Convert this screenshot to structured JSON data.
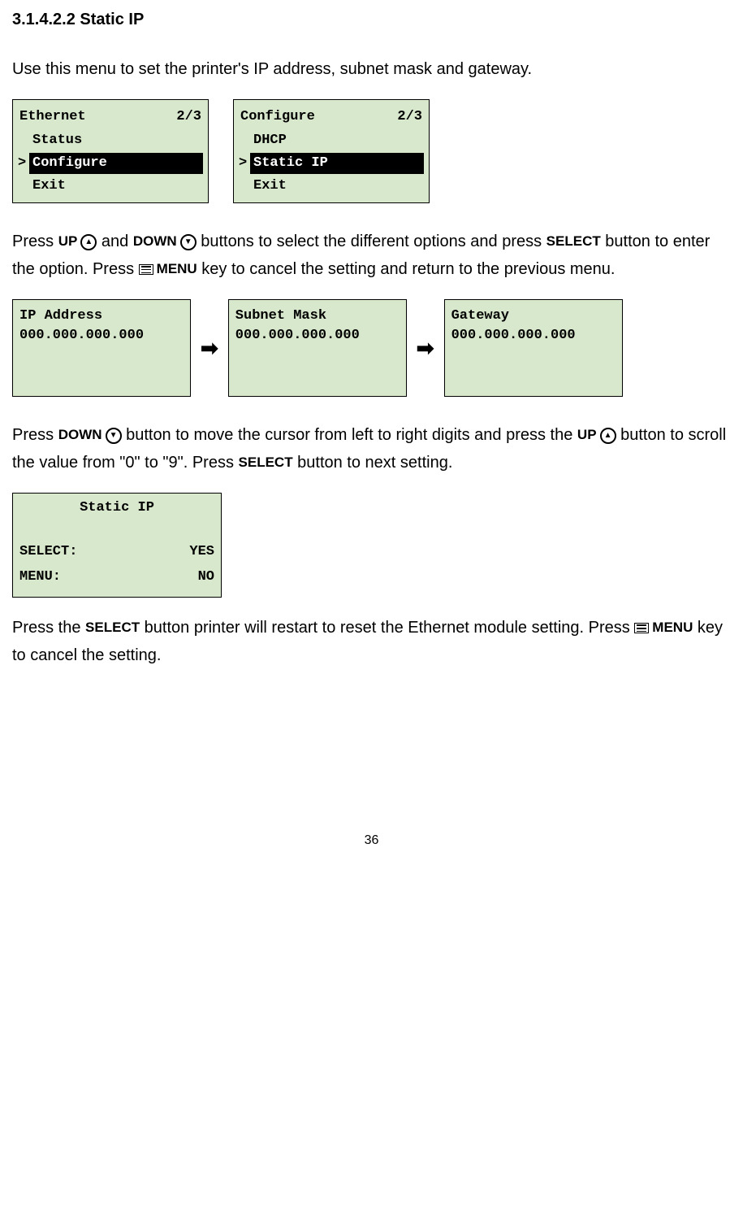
{
  "heading": "3.1.4.2.2 Static IP",
  "intro": "Use this menu to set the printer's IP address, subnet mask and gateway.",
  "lcd1": {
    "title": "Ethernet",
    "page": "2/3",
    "items": [
      "Status",
      "Configure",
      "Exit"
    ],
    "selected": "Configure"
  },
  "lcd2": {
    "title": "Configure",
    "page": "2/3",
    "items": [
      "DHCP",
      "Static IP",
      "Exit"
    ],
    "selected": "Static IP"
  },
  "buttons": {
    "up": "UP",
    "down": "DOWN",
    "select": "SELECT",
    "menu": "MENU"
  },
  "para1_parts": {
    "a": "Press ",
    "b": " and ",
    "c": " buttons to select the different options and press ",
    "d": " button to enter the option. Press ",
    "e": " key to cancel the setting and return to the previous menu."
  },
  "ip_screens": {
    "ip": {
      "title": "IP Address",
      "value": "000.000.000.000"
    },
    "subnet": {
      "title": "Subnet Mask",
      "value": "000.000.000.000"
    },
    "gateway": {
      "title": "Gateway",
      "value": "000.000.000.000"
    }
  },
  "para2_parts": {
    "a": "Press ",
    "b": " button to move the cursor from left to right digits and press the ",
    "c": " button to scroll the value from \"0\" to \"9\". Press ",
    "d": " button to next setting."
  },
  "confirm": {
    "title": "Static IP",
    "line1_l": "SELECT:",
    "line1_r": "YES",
    "line2_l": "MENU:",
    "line2_r": "NO"
  },
  "para3_parts": {
    "a": "Press the ",
    "b": " button printer will restart to reset the Ethernet module setting. Press ",
    "c": " key to cancel the setting."
  },
  "page_number": "36"
}
